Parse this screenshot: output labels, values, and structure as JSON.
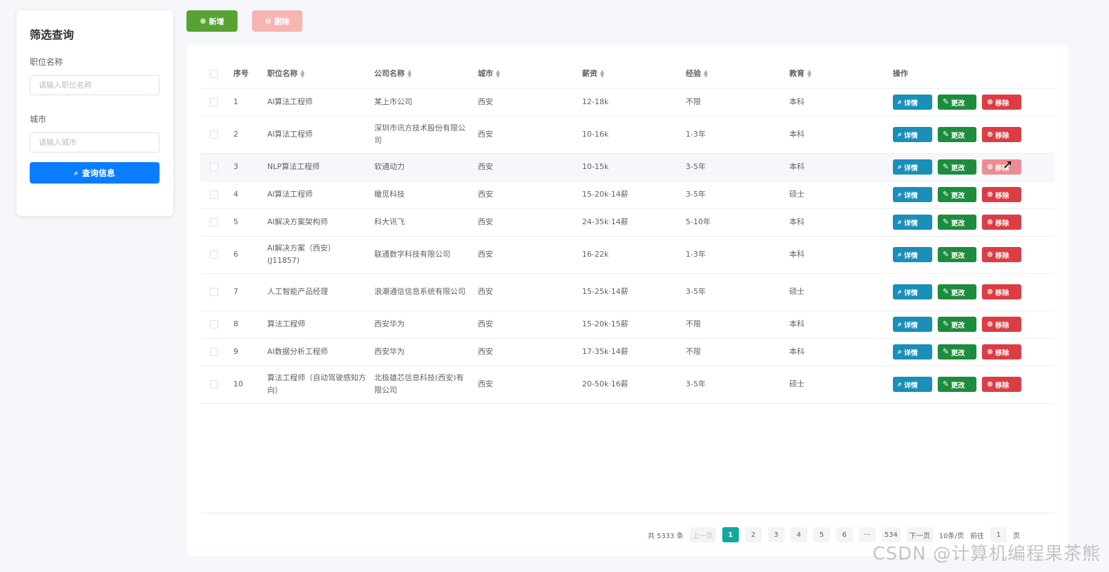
{
  "filter": {
    "title": "筛选查询",
    "job_label": "职位名称",
    "job_placeholder": "请输入职位名称",
    "city_label": "城市",
    "city_placeholder": "请输入城市",
    "query_button": "查询信息"
  },
  "toolbar": {
    "add_label": "新增",
    "delete_label": "删除"
  },
  "table": {
    "headers": {
      "index": "序号",
      "job": "职位名称",
      "company": "公司名称",
      "city": "城市",
      "salary": "薪资",
      "experience": "经验",
      "education": "教育",
      "actions": "操作"
    },
    "action_labels": {
      "detail": "详情",
      "edit": "更改",
      "remove": "移除"
    },
    "rows": [
      {
        "index": "1",
        "job": "AI算法工程师",
        "company": "某上市公司",
        "city": "西安",
        "salary": "12-18k",
        "experience": "不限",
        "education": "本科"
      },
      {
        "index": "2",
        "job": "AI算法工程师",
        "company": "深圳市讯方技术股份有限公司",
        "city": "西安",
        "salary": "10-16k",
        "experience": "1-3年",
        "education": "本科"
      },
      {
        "index": "3",
        "job": "NLP算法工程师",
        "company": "软通动力",
        "city": "西安",
        "salary": "10-15k",
        "experience": "3-5年",
        "education": "本科"
      },
      {
        "index": "4",
        "job": "AI算法工程师",
        "company": "瞰觅科技",
        "city": "西安",
        "salary": "15-20k·14薪",
        "experience": "3-5年",
        "education": "硕士"
      },
      {
        "index": "5",
        "job": "AI解决方案架构师",
        "company": "科大讯飞",
        "city": "西安",
        "salary": "24-35k·14薪",
        "experience": "5-10年",
        "education": "本科"
      },
      {
        "index": "6",
        "job": "AI解决方案（西安）(J11857)",
        "company": "联通数字科技有限公司",
        "city": "西安",
        "salary": "16-22k",
        "experience": "1-3年",
        "education": "本科"
      },
      {
        "index": "7",
        "job": "人工智能产品经理",
        "company": "浪潮通信信息系统有限公司",
        "city": "西安",
        "salary": "15-25k·14薪",
        "experience": "3-5年",
        "education": "硕士"
      },
      {
        "index": "8",
        "job": "算法工程师",
        "company": "西安华为",
        "city": "西安",
        "salary": "15-20k·15薪",
        "experience": "不限",
        "education": "本科"
      },
      {
        "index": "9",
        "job": "AI数据分析工程师",
        "company": "西安华为",
        "city": "西安",
        "salary": "17-35k·14薪",
        "experience": "不限",
        "education": "本科"
      },
      {
        "index": "10",
        "job": "算法工程师（自动驾驶感知方向）",
        "company": "北极雄芯信息科技(西安)有限公司",
        "city": "西安",
        "salary": "20-50k·16薪",
        "experience": "3-5年",
        "education": "硕士"
      }
    ]
  },
  "pagination": {
    "total": "共 5333 条",
    "prev": "上一页",
    "pages": [
      "1",
      "2",
      "3",
      "4",
      "5",
      "6",
      "···",
      "534"
    ],
    "next": "下一页",
    "page_size": "10条/页",
    "goto": "前往",
    "goto_value": "1",
    "page_unit": "页"
  },
  "watermark": "CSDN @计算机编程果茶熊"
}
